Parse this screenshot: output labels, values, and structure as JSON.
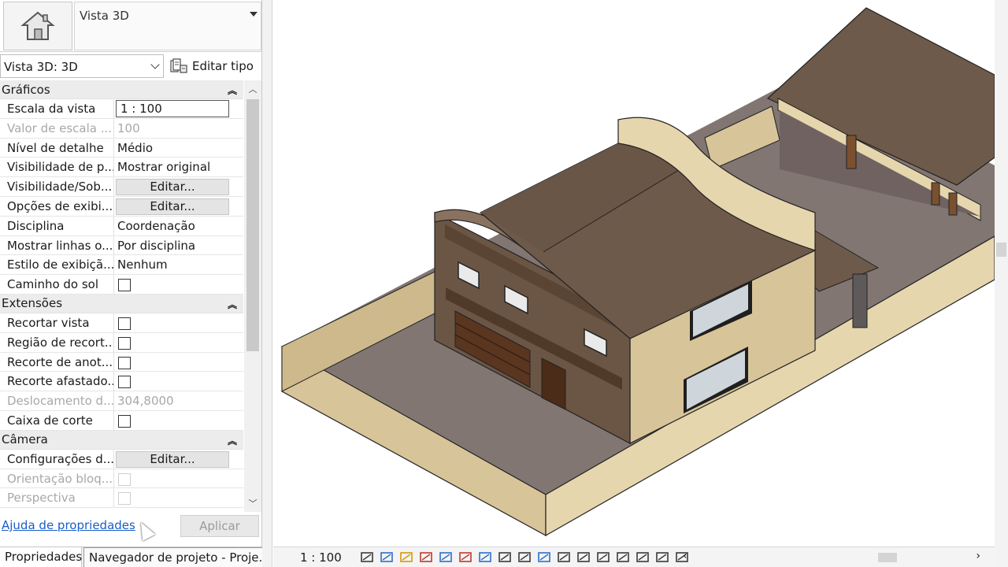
{
  "type_selector": {
    "family_name": "Vista 3D",
    "icon": "house-3d-icon"
  },
  "instance": {
    "selected": "Vista 3D: 3D",
    "edit_type_label": "Editar tipo"
  },
  "categories": [
    {
      "label": "Gráficos",
      "rows": [
        {
          "name": "Escala da vista",
          "value": "1 : 100",
          "kind": "input"
        },
        {
          "name": "Valor de escala  ...",
          "value": "100",
          "kind": "text",
          "disabled": true
        },
        {
          "name": "Nível de detalhe",
          "value": "Médio",
          "kind": "text"
        },
        {
          "name": "Visibilidade de p...",
          "value": "Mostrar original",
          "kind": "text"
        },
        {
          "name": "Visibilidade/Sob...",
          "value": "Editar...",
          "kind": "button"
        },
        {
          "name": "Opções de exibi...",
          "value": "Editar...",
          "kind": "button"
        },
        {
          "name": "Disciplina",
          "value": "Coordenação",
          "kind": "text"
        },
        {
          "name": "Mostrar linhas o...",
          "value": "Por disciplina",
          "kind": "text"
        },
        {
          "name": "Estilo de exibiçã...",
          "value": "Nenhum",
          "kind": "text"
        },
        {
          "name": "Caminho do sol",
          "value": "",
          "kind": "checkbox"
        }
      ]
    },
    {
      "label": "Extensões",
      "rows": [
        {
          "name": "Recortar vista",
          "value": "",
          "kind": "checkbox"
        },
        {
          "name": "Região de recort...",
          "value": "",
          "kind": "checkbox"
        },
        {
          "name": "Recorte de anot...",
          "value": "",
          "kind": "checkbox"
        },
        {
          "name": "Recorte afastado...",
          "value": "",
          "kind": "checkbox"
        },
        {
          "name": "Deslocamento d...",
          "value": "304,8000",
          "kind": "text",
          "disabled": true
        },
        {
          "name": "Caixa de corte",
          "value": "",
          "kind": "checkbox"
        }
      ]
    },
    {
      "label": "Câmera",
      "rows": [
        {
          "name": "Configurações d...",
          "value": "Editar...",
          "kind": "button"
        },
        {
          "name": "Orientação bloq...",
          "value": "",
          "kind": "checkbox",
          "disabled": true
        },
        {
          "name": "Perspectiva",
          "value": "",
          "kind": "checkbox",
          "disabled": true
        }
      ]
    }
  ],
  "footer": {
    "help_link": "Ajuda de propriedades",
    "apply_label": "Aplicar"
  },
  "tabs": [
    {
      "label": "Propriedades",
      "active": true
    },
    {
      "label": "Navegador de projeto - Proje...",
      "active": false
    }
  ],
  "status_bar": {
    "scale": "1 : 100",
    "view_control_icons": [
      "detail-level-icon",
      "visual-style-icon",
      "sun-path-icon",
      "shadows-icon",
      "render-icon",
      "crop-view-icon",
      "show-crop-icon",
      "unlock-3d-icon",
      "temporary-hide-icon",
      "reveal-hidden-icon",
      "worksharing-icon",
      "analytical-model-icon",
      "highlight-displacement-icon",
      "constraints-icon",
      "lock-view-icon",
      "rendering-dialog-icon",
      "section-box-icon"
    ]
  },
  "colors": {
    "link": "#1a5ec8",
    "roof": "#6e5a4a",
    "wall_beige": "#d8c499",
    "wall_brown": "#6b5645",
    "floor": "#7c716d"
  }
}
